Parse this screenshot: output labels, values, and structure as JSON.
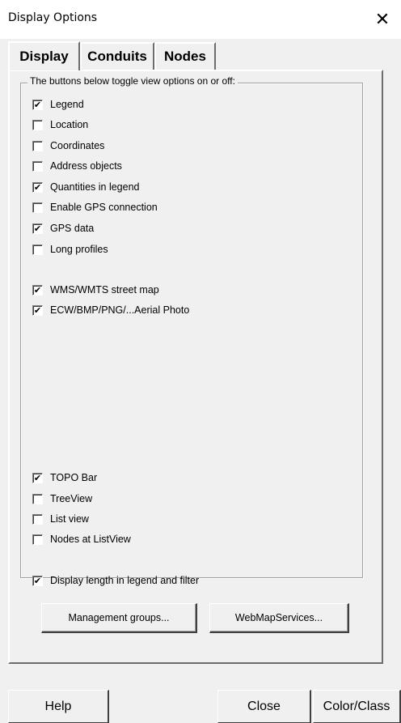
{
  "window": {
    "title": "Display Options",
    "close_glyph": "✕"
  },
  "tabs": [
    "Display",
    "Conduits",
    "Nodes"
  ],
  "group": {
    "caption": "The buttons below toggle view options on or off:"
  },
  "checkboxes": [
    {
      "label": "Legend",
      "checked": true
    },
    {
      "label": "Location",
      "checked": false
    },
    {
      "label": "Coordinates",
      "checked": false
    },
    {
      "label": "Address objects",
      "checked": false
    },
    {
      "label": "Quantities in legend",
      "checked": true
    },
    {
      "label": "Enable GPS connection",
      "checked": false
    },
    {
      "label": "GPS data",
      "checked": true
    },
    {
      "label": "Long profiles",
      "checked": false
    },
    {
      "label": "WMS/WMTS street map",
      "checked": true
    },
    {
      "label": "ECW/BMP/PNG/...Aerial Photo",
      "checked": true
    },
    {
      "label": "TOPO Bar",
      "checked": true
    },
    {
      "label": "TreeView",
      "checked": false
    },
    {
      "label": "List view",
      "checked": false
    },
    {
      "label": "Nodes at ListView",
      "checked": false
    },
    {
      "label": "Display length in legend and filter",
      "checked": true
    }
  ],
  "group_buttons": {
    "management": "Management groups...",
    "webmap": "WebMapServices..."
  },
  "footer": {
    "help": "Help",
    "close": "Close",
    "colorclass": "Color/Class"
  },
  "check_glyph": "✔"
}
